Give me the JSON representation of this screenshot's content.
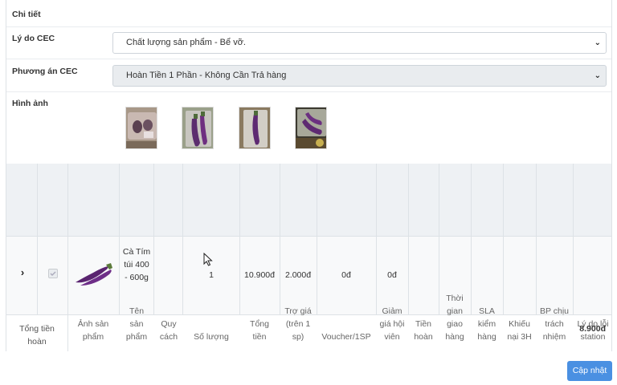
{
  "form": {
    "detail_label": "Chi tiết",
    "reason_label": "Lý do CEC",
    "reason_value": "Chất lượng sản phẩm - Bể vỡ.",
    "plan_label": "Phương án CEC",
    "plan_value": "Hoàn Tiền 1 Phần - Không Cần Trả hàng",
    "images_label": "Hình ảnh"
  },
  "table": {
    "headers": {
      "image": "Ảnh sản phẩm",
      "name": "Tên sản phẩm",
      "spec": "Quy cách",
      "qty": "Số lượng",
      "total": "Tổng tiền",
      "subsidy": "Trợ giá (trên 1 sp)",
      "voucher": "Voucher/1SP",
      "member_discount": "Giảm giá hội viên",
      "refund": "Tiền hoàn",
      "delivery_time": "Thời gian giao hàng",
      "sla": "SLA kiểm hàng",
      "complaint": "Khiếu nại 3H",
      "dept": "BP chịu trách nhiệm",
      "station_error": "Lý do lỗi station"
    },
    "row": {
      "name": "Cà Tím túi 400 - 600g",
      "spec": "",
      "qty": "1",
      "total": "10.900đ",
      "subsidy": "2.000đ",
      "voucher": "0đ",
      "member_discount": "0đ"
    },
    "footer": {
      "label": "Tổng tiền hoàn",
      "value": "8.900đ"
    }
  },
  "actions": {
    "update": "Cập nhật"
  }
}
